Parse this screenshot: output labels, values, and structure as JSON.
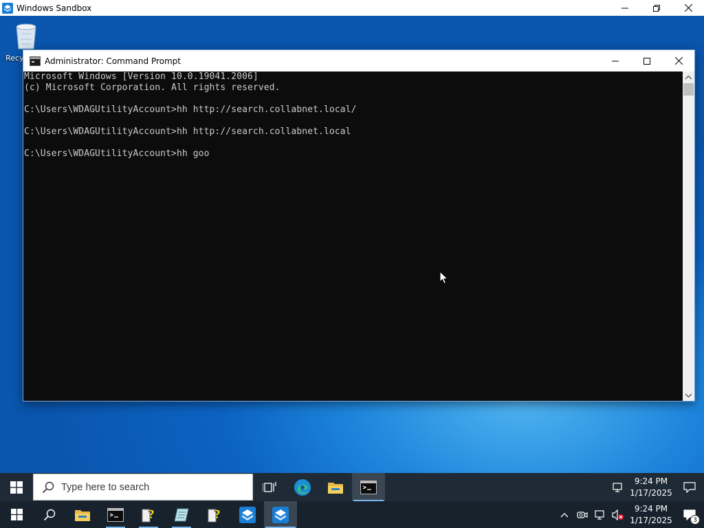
{
  "sandbox_window": {
    "title": "Windows Sandbox",
    "controls": [
      "minimize",
      "restore",
      "close"
    ]
  },
  "desktop": {
    "icons": [
      {
        "label": "Recycle Bin",
        "icon": "recycle-bin-icon"
      }
    ]
  },
  "cmd_window": {
    "title": "Administrator: Command Prompt",
    "lines": [
      "Microsoft Windows [Version 10.0.19041.2006]",
      "(c) Microsoft Corporation. All rights reserved.",
      "",
      "C:\\Users\\WDAGUtilityAccount>hh http://search.collabnet.local/",
      "",
      "C:\\Users\\WDAGUtilityAccount>hh http://search.collabnet.local",
      "",
      "C:\\Users\\WDAGUtilityAccount>hh goo"
    ]
  },
  "taskbar_inner": {
    "search_placeholder": "Type here to search",
    "apps": [
      {
        "name": "task-view",
        "icon": "task-view-icon"
      },
      {
        "name": "edge",
        "icon": "edge-icon"
      },
      {
        "name": "file-explorer",
        "icon": "folder-icon"
      },
      {
        "name": "command-prompt",
        "icon": "cmd-icon",
        "active": true
      }
    ],
    "clock": {
      "time": "9:24 PM",
      "date": "1/17/2025"
    }
  },
  "taskbar_host": {
    "apps": [
      {
        "name": "file-explorer",
        "icon": "folder-icon"
      },
      {
        "name": "command-prompt",
        "icon": "cmd-icon"
      },
      {
        "name": "help-script-1",
        "icon": "help-file-icon"
      },
      {
        "name": "notepad-tool",
        "icon": "notepad-icon"
      },
      {
        "name": "help-script-2",
        "icon": "help-file-icon"
      },
      {
        "name": "windows-sandbox-1",
        "icon": "sandbox-icon"
      },
      {
        "name": "windows-sandbox-2",
        "icon": "sandbox-icon",
        "active": true
      }
    ],
    "clock": {
      "time": "9:24 PM",
      "date": "1/17/2025"
    },
    "notification_count": "3"
  },
  "colors": {
    "console_bg": "#0c0c0c",
    "console_text": "#cccccc",
    "taskbar": "#1e2a35",
    "accent": "#0078d7"
  }
}
